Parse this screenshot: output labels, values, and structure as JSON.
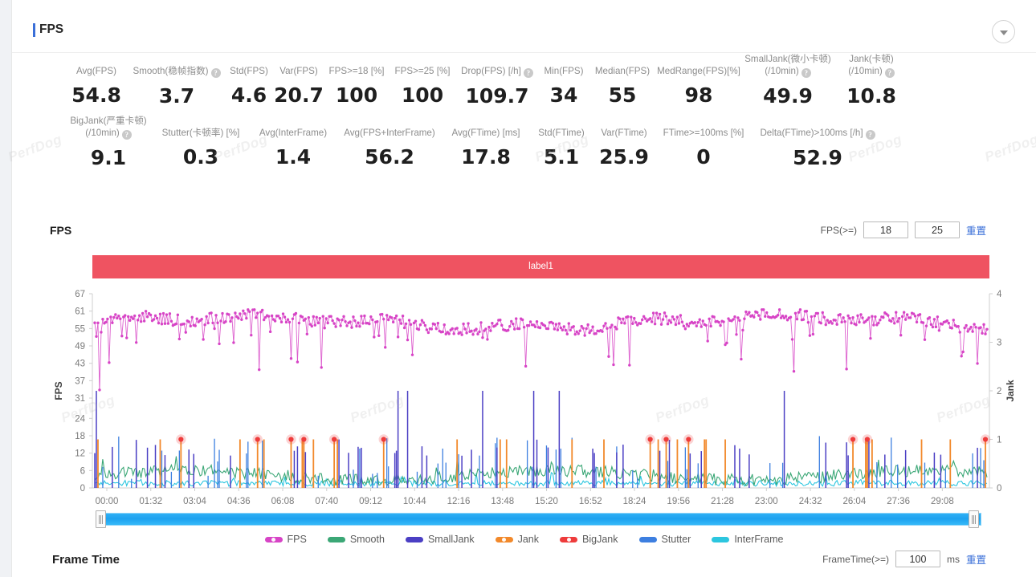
{
  "header": {
    "title": "FPS",
    "collapse_icon": "chevron-down-icon"
  },
  "watermark": "PerfDog",
  "metrics_row1": [
    {
      "label": "Avg(FPS)",
      "value": "54.8",
      "help": false
    },
    {
      "label": "Smooth(稳帧指数)",
      "value": "3.7",
      "help": true
    },
    {
      "label": "Std(FPS)",
      "value": "4.6",
      "help": false
    },
    {
      "label": "Var(FPS)",
      "value": "20.7",
      "help": false
    },
    {
      "label": "FPS>=18 [%]",
      "value": "100",
      "help": false
    },
    {
      "label": "FPS>=25 [%]",
      "value": "100",
      "help": false
    },
    {
      "label": "Drop(FPS) [/h]",
      "value": "109.7",
      "help": true
    },
    {
      "label": "Min(FPS)",
      "value": "34",
      "help": false
    },
    {
      "label": "Median(FPS)",
      "value": "55",
      "help": false
    },
    {
      "label": "MedRange(FPS)[%]",
      "value": "98",
      "help": false
    },
    {
      "label": "SmallJank(微小卡顿)\n(/10min)",
      "value": "49.9",
      "help": true
    },
    {
      "label": "Jank(卡顿)\n(/10min)",
      "value": "10.8",
      "help": true
    }
  ],
  "metrics_row2": [
    {
      "label": "BigJank(严重卡顿)\n(/10min)",
      "value": "9.1",
      "help": true
    },
    {
      "label": "Stutter(卡顿率) [%]",
      "value": "0.3",
      "help": false
    },
    {
      "label": "Avg(InterFrame)",
      "value": "1.4",
      "help": false
    },
    {
      "label": "Avg(FPS+InterFrame)",
      "value": "56.2",
      "help": false
    },
    {
      "label": "Avg(FTime) [ms]",
      "value": "17.8",
      "help": false
    },
    {
      "label": "Std(FTime)",
      "value": "5.1",
      "help": false
    },
    {
      "label": "Var(FTime)",
      "value": "25.9",
      "help": false
    },
    {
      "label": "FTime>=100ms [%]",
      "value": "0",
      "help": false
    },
    {
      "label": "Delta(FTime)>100ms [/h]",
      "value": "52.9",
      "help": true
    }
  ],
  "fps_section": {
    "title": "FPS",
    "control_label": "FPS(>=)",
    "threshold_low": "18",
    "threshold_high": "25",
    "reset_label": "重置"
  },
  "frametime_section": {
    "title": "Frame Time",
    "control_label": "FrameTime(>=)",
    "threshold": "100",
    "unit": "ms",
    "reset_label": "重置"
  },
  "chart_data": {
    "type": "line",
    "title": "FPS",
    "band_label": "label1",
    "band_color": "#ef5361",
    "xlabel": "",
    "ylabel": "FPS",
    "y2label": "Jank",
    "grid": false,
    "legend_position": "bottom",
    "yticks": [
      0,
      6,
      12,
      18,
      24,
      31,
      37,
      43,
      49,
      55,
      61,
      67
    ],
    "ylim": [
      0,
      67
    ],
    "y2ticks": [
      0,
      1,
      2,
      3,
      4
    ],
    "y2lim": [
      0,
      4
    ],
    "xticks": [
      "00:00",
      "01:32",
      "03:04",
      "04:36",
      "06:08",
      "07:40",
      "09:12",
      "10:44",
      "12:16",
      "13:48",
      "15:20",
      "16:52",
      "18:24",
      "19:56",
      "21:28",
      "23:00",
      "24:32",
      "26:04",
      "27:36",
      "29:08"
    ],
    "series": [
      {
        "name": "FPS",
        "color": "#d744c6",
        "axis": "left",
        "mean": 56,
        "min": 34,
        "max": 61
      },
      {
        "name": "Smooth",
        "color": "#3ba776",
        "axis": "left",
        "mean": 4,
        "min": 0,
        "max": 9
      },
      {
        "name": "SmallJank",
        "color": "#4b3fc4",
        "axis": "right",
        "mean": 0,
        "min": 0,
        "max": 2
      },
      {
        "name": "Jank",
        "color": "#f2892b",
        "axis": "right",
        "mean": 0,
        "min": 0,
        "max": 1
      },
      {
        "name": "BigJank",
        "color": "#ee3b3b",
        "axis": "right",
        "mean": 0,
        "min": 0,
        "max": 1
      },
      {
        "name": "Stutter",
        "color": "#3d7fe0",
        "axis": "left",
        "mean": 1,
        "min": 0,
        "max": 18
      },
      {
        "name": "InterFrame",
        "color": "#2cc6df",
        "axis": "left",
        "mean": 1,
        "min": 0,
        "max": 4
      }
    ]
  },
  "legend": [
    {
      "label": "FPS",
      "color": "#d744c6",
      "dot": true
    },
    {
      "label": "Smooth",
      "color": "#3ba776",
      "dot": false
    },
    {
      "label": "SmallJank",
      "color": "#4b3fc4",
      "dot": false
    },
    {
      "label": "Jank",
      "color": "#f2892b",
      "dot": true
    },
    {
      "label": "BigJank",
      "color": "#ee3b3b",
      "dot": true
    },
    {
      "label": "Stutter",
      "color": "#3d7fe0",
      "dot": false
    },
    {
      "label": "InterFrame",
      "color": "#2cc6df",
      "dot": false
    }
  ]
}
